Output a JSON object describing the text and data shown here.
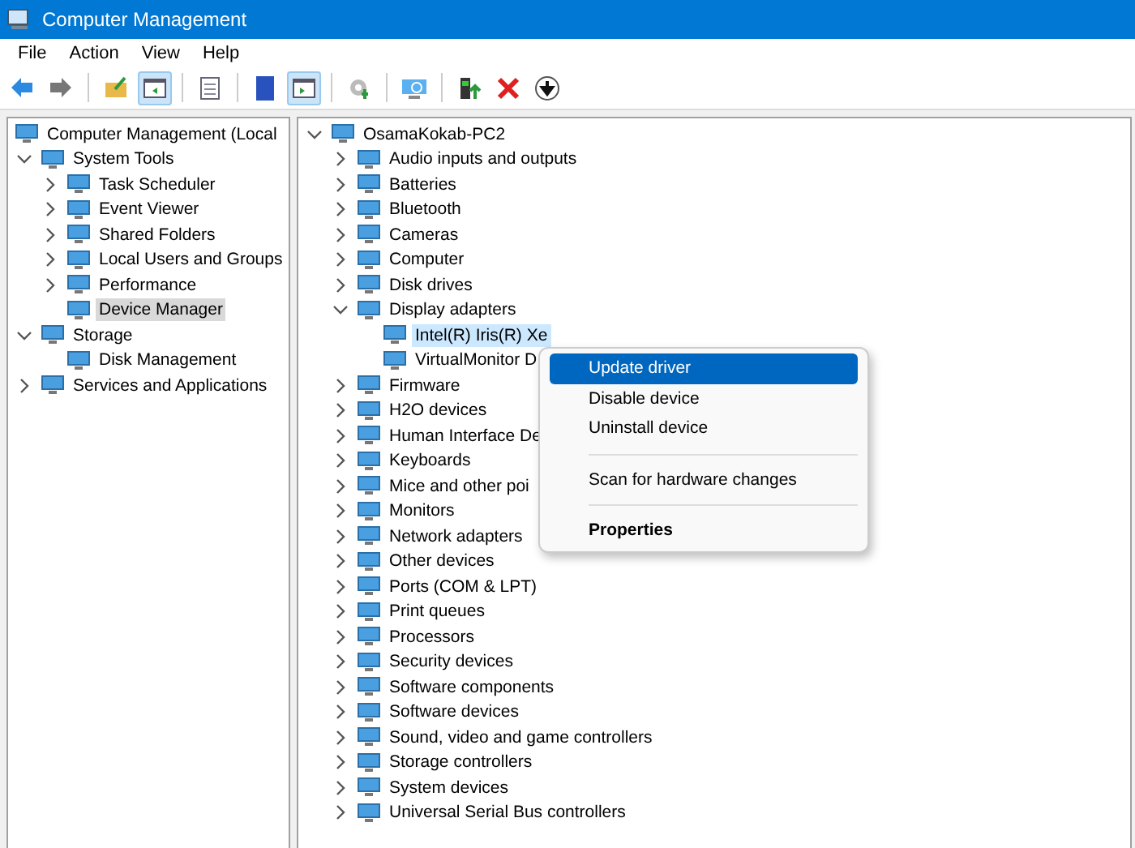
{
  "window": {
    "title": "Computer Management"
  },
  "menu_bar": [
    "File",
    "Action",
    "View",
    "Help"
  ],
  "toolbar": [
    {
      "kind": "button",
      "pressed": false
    },
    {
      "kind": "button",
      "pressed": false
    },
    {
      "kind": "separator"
    },
    {
      "kind": "button",
      "pressed": false
    },
    {
      "kind": "button",
      "pressed": true
    },
    {
      "kind": "separator"
    },
    {
      "kind": "button",
      "pressed": false
    },
    {
      "kind": "separator"
    },
    {
      "kind": "button",
      "pressed": false
    },
    {
      "kind": "button",
      "pressed": true
    },
    {
      "kind": "separator"
    },
    {
      "kind": "button",
      "pressed": false
    },
    {
      "kind": "separator"
    },
    {
      "kind": "button",
      "pressed": false
    },
    {
      "kind": "separator"
    },
    {
      "kind": "button",
      "pressed": false
    },
    {
      "kind": "button",
      "pressed": false
    },
    {
      "kind": "button",
      "pressed": false
    }
  ],
  "console_tree": [
    {
      "label": "Computer Management (Local",
      "selected": false,
      "children": [
        {
          "label": "System Tools",
          "expanded": true,
          "selected": false,
          "children": [
            {
              "label": "Task Scheduler",
              "expanded": false,
              "selected": false
            },
            {
              "label": "Event Viewer",
              "expanded": false,
              "selected": false
            },
            {
              "label": "Shared Folders",
              "expanded": false,
              "selected": false
            },
            {
              "label": "Local Users and Groups",
              "expanded": false,
              "selected": false
            },
            {
              "label": "Performance",
              "expanded": false,
              "selected": false
            },
            {
              "label": "Device Manager",
              "selected": true
            }
          ]
        },
        {
          "label": "Storage",
          "expanded": true,
          "selected": false,
          "children": [
            {
              "label": "Disk Management",
              "selected": false
            }
          ]
        },
        {
          "label": "Services and Applications",
          "expanded": false,
          "selected": false
        }
      ]
    }
  ],
  "device_tree": [
    {
      "label": "OsamaKokab-PC2",
      "expanded": true,
      "selected": false,
      "children": [
        {
          "label": "Audio inputs and outputs",
          "expanded": false,
          "selected": false
        },
        {
          "label": "Batteries",
          "expanded": false,
          "selected": false
        },
        {
          "label": "Bluetooth",
          "expanded": false,
          "selected": false
        },
        {
          "label": "Cameras",
          "expanded": false,
          "selected": false
        },
        {
          "label": "Computer",
          "expanded": false,
          "selected": false
        },
        {
          "label": "Disk drives",
          "expanded": false,
          "selected": false
        },
        {
          "label": "Display adapters",
          "expanded": true,
          "selected": false,
          "children": [
            {
              "label": "Intel(R) Iris(R) Xe",
              "selected": true
            },
            {
              "label": "VirtualMonitor D",
              "selected": false
            }
          ]
        },
        {
          "label": "Firmware",
          "expanded": false,
          "selected": false
        },
        {
          "label": "H2O devices",
          "expanded": false,
          "selected": false
        },
        {
          "label": "Human Interface De",
          "expanded": false,
          "selected": false
        },
        {
          "label": "Keyboards",
          "expanded": false,
          "selected": false
        },
        {
          "label": "Mice and other poi",
          "expanded": false,
          "selected": false
        },
        {
          "label": "Monitors",
          "expanded": false,
          "selected": false
        },
        {
          "label": "Network adapters",
          "expanded": false,
          "selected": false
        },
        {
          "label": "Other devices",
          "expanded": false,
          "selected": false
        },
        {
          "label": "Ports (COM & LPT)",
          "expanded": false,
          "selected": false
        },
        {
          "label": "Print queues",
          "expanded": false,
          "selected": false
        },
        {
          "label": "Processors",
          "expanded": false,
          "selected": false
        },
        {
          "label": "Security devices",
          "expanded": false,
          "selected": false
        },
        {
          "label": "Software components",
          "expanded": false,
          "selected": false
        },
        {
          "label": "Software devices",
          "expanded": false,
          "selected": false
        },
        {
          "label": "Sound, video and game controllers",
          "expanded": false,
          "selected": false
        },
        {
          "label": "Storage controllers",
          "expanded": false,
          "selected": false
        },
        {
          "label": "System devices",
          "expanded": false,
          "selected": false
        },
        {
          "label": "Universal Serial Bus controllers",
          "expanded": false,
          "selected": false
        }
      ]
    }
  ],
  "context_menu": [
    {
      "kind": "item",
      "label": "Update driver",
      "selected": true,
      "default": false
    },
    {
      "kind": "item",
      "label": "Disable device",
      "selected": false,
      "default": false
    },
    {
      "kind": "item",
      "label": "Uninstall device",
      "selected": false,
      "default": false
    },
    {
      "kind": "separator"
    },
    {
      "kind": "item",
      "label": "Scan for hardware changes",
      "selected": false,
      "default": false
    },
    {
      "kind": "separator"
    },
    {
      "kind": "item",
      "label": "Properties",
      "selected": false,
      "default": true
    }
  ]
}
